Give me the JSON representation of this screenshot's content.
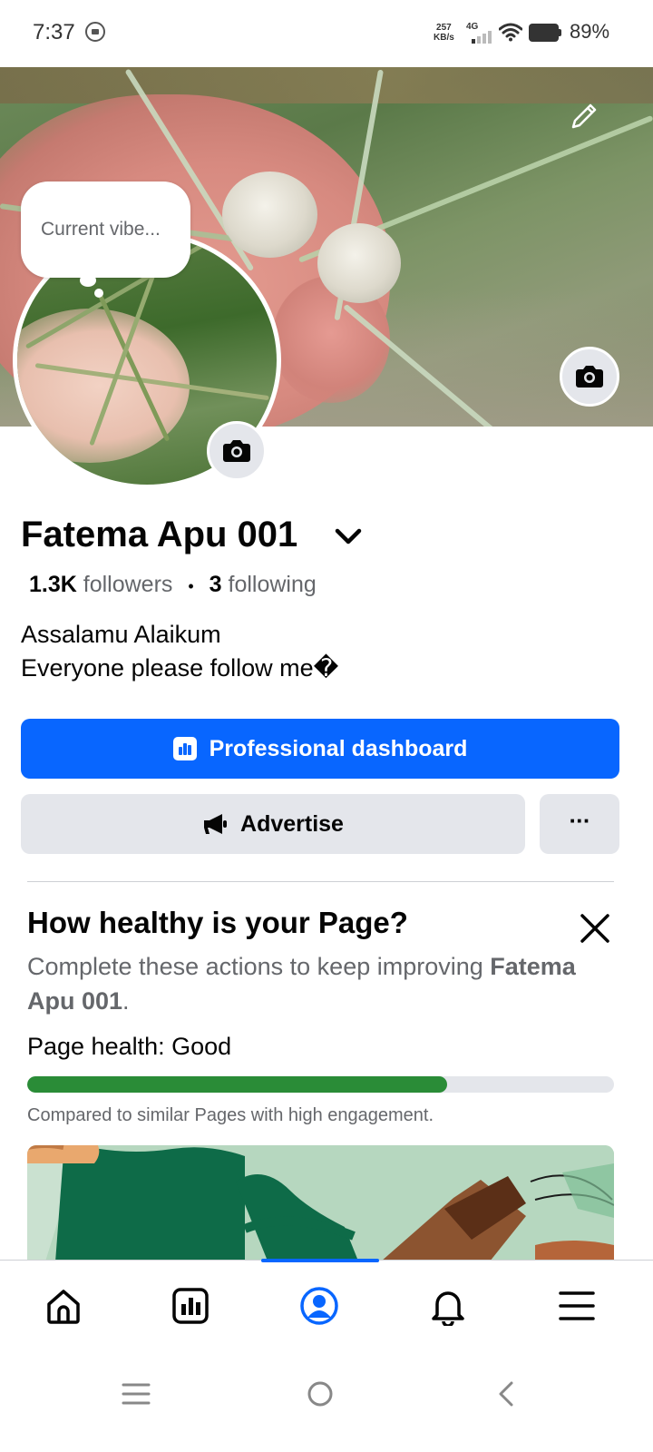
{
  "status_bar": {
    "time": "7:37",
    "net_speed_value": "257",
    "net_speed_unit": "KB/s",
    "network_type": "4G",
    "battery": "89%"
  },
  "profile": {
    "vibe_placeholder": "Current vibe...",
    "name": "Fatema Apu 001",
    "followers_count": "1.3K",
    "followers_label": "followers",
    "separator": "•",
    "following_count": "3",
    "following_label": "following",
    "bio": "Assalamu Alaikum\nEveryone please follow me�"
  },
  "actions": {
    "dashboard_label": "Professional dashboard",
    "advertise_label": "Advertise",
    "more_label": "···"
  },
  "page_health": {
    "title": "How healthy is your Page?",
    "desc_prefix": "Complete these actions to keep improving ",
    "desc_name": "Fatema Apu 001",
    "desc_suffix": ".",
    "health_label": "Page health:",
    "health_value": "Good",
    "progress_fraction": 0.716,
    "note": "Compared to similar Pages with high engagement."
  },
  "bottom_nav": {
    "items": [
      {
        "icon": "home-icon"
      },
      {
        "icon": "dashboard-icon"
      },
      {
        "icon": "profile-icon",
        "active": true
      },
      {
        "icon": "bell-icon"
      },
      {
        "icon": "menu-icon"
      }
    ]
  },
  "colors": {
    "accent": "#0866ff",
    "health_good": "#2a8c37",
    "secondary_button": "#e4e6eb"
  }
}
